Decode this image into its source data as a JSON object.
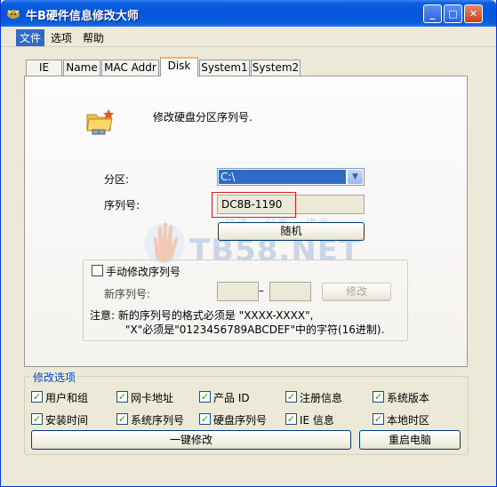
{
  "window": {
    "title": "牛B硬件信息修改大师",
    "controls": {
      "minimize": "_",
      "maximize": "□",
      "close": "✕"
    }
  },
  "menu": [
    "文件",
    "选项",
    "帮助"
  ],
  "tabs": [
    "IE",
    "Name",
    "MAC Addr",
    "Disk",
    "System1",
    "System2"
  ],
  "active_tab": "Disk",
  "disk_panel": {
    "description": "修改硬盘分区序列号.",
    "partition_label": "分区:",
    "partition_value": "C:\\",
    "serial_label": "序列号:",
    "serial_value": "DC8B-1190",
    "random_button": "随机",
    "manual_checkbox": "手动修改序列号",
    "manual_checked": false,
    "new_serial_label": "新序列号:",
    "new_serial_part1": "",
    "new_serial_part2": "",
    "dash": "–",
    "modify_button": "修改",
    "note_line1": "注意: 新的序列号的格式必须是 \"XXXX-XXXX\",",
    "note_line2": "\"X\"必须是\"0123456789ABCDEF\"中的字符(16进制)."
  },
  "watermark": {
    "text": "TB58.NET",
    "slogan": "交流 - 分享 - 进步"
  },
  "options": {
    "title": "修改选项",
    "items": [
      {
        "label": "用户和组",
        "checked": true
      },
      {
        "label": "网卡地址",
        "checked": true
      },
      {
        "label": "产品 ID",
        "checked": true
      },
      {
        "label": "注册信息",
        "checked": true
      },
      {
        "label": "系统版本",
        "checked": true
      },
      {
        "label": "安装时间",
        "checked": true
      },
      {
        "label": "系统序列号",
        "checked": true
      },
      {
        "label": "硬盘序列号",
        "checked": true
      },
      {
        "label": "IE 信息",
        "checked": true
      },
      {
        "label": "本地时区",
        "checked": true
      }
    ],
    "one_click_button": "一键修改",
    "restart_button": "重启电脑"
  },
  "icons": {
    "app": "cow-app-icon",
    "disk": "folder-network-disk-icon",
    "check": "checkmark-icon",
    "combo_arrow": "chevron-down-icon"
  },
  "colors": {
    "titlebar": "#0554d8",
    "window_bg": "#ece9d8",
    "highlight_border": "#d81e1e",
    "check_mark": "#21a121",
    "group_title": "#0046d5"
  }
}
